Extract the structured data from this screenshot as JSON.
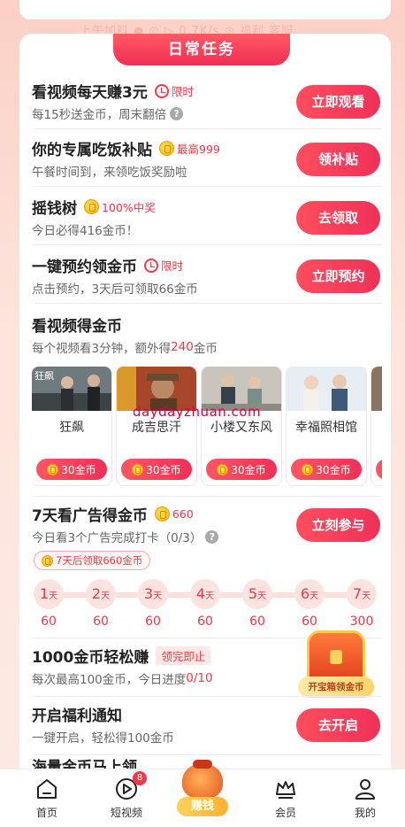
{
  "ghost_text": "上午加料 ● ◎ ▷ 0.7K/s ◎ 福利 客服",
  "section_title": "日常任务",
  "tasks": [
    {
      "name": "看视频每天赚3元",
      "badge": "限时",
      "desc": "每15秒送金币，周末翻倍",
      "button": "立即观看"
    },
    {
      "name": "你的专属吃饭补贴",
      "badge": "最高999",
      "desc": "午餐时间到，来领吃饭奖励啦",
      "button": "领补贴"
    },
    {
      "name": "摇钱树",
      "badge": "100%中奖",
      "desc": "今日必得416金币！",
      "button": "去领取"
    },
    {
      "name": "一键预约领金币",
      "badge": "限时",
      "desc": "点击预约，3天后可领取66金币",
      "button": "立即预约"
    }
  ],
  "video_section": {
    "title": "看视频得金币",
    "desc_prefix": "每个视频看3分钟，额外得",
    "desc_highlight": "240",
    "desc_suffix": "金币",
    "videos": [
      {
        "title": "狂飙",
        "reward": "30金币",
        "poster_text": "狂飙"
      },
      {
        "title": "成吉思汗",
        "reward": "30金币"
      },
      {
        "title": "小楼又东风",
        "reward": "30金币"
      },
      {
        "title": "幸福照相馆",
        "reward": "30金币"
      }
    ]
  },
  "watermark": "daydayzhuan.com",
  "ad_task": {
    "name": "7天看广告得金币",
    "badge": "660",
    "desc": "今日看3个广告完成打卡（0/3）",
    "button": "立刻参与",
    "chip": "7天后领取660金币",
    "day_unit": "天",
    "days": [
      {
        "day": "1",
        "reward": "60"
      },
      {
        "day": "2",
        "reward": "60"
      },
      {
        "day": "3",
        "reward": "60"
      },
      {
        "day": "4",
        "reward": "60"
      },
      {
        "day": "5",
        "reward": "60"
      },
      {
        "day": "6",
        "reward": "60"
      },
      {
        "day": "7",
        "reward": "300"
      }
    ]
  },
  "easy_task": {
    "name": "1000金币轻松赚",
    "tag": "领完即止",
    "desc_prefix": "每次最高100金币，今日进度",
    "desc_progress": "0/10"
  },
  "treasure_label": "开宝箱领金币",
  "notify_task": {
    "name": "开启福利通知",
    "desc": "一键开启，轻松得100金币",
    "button": "去开启"
  },
  "next_task_partial": "海量金币马上领",
  "nav": {
    "home": "首页",
    "shorts": "短视频",
    "shorts_badge": "8",
    "earn": "赚钱",
    "member": "会员",
    "mine": "我的"
  },
  "colors": {
    "accent": "#f0394b",
    "background": "#fde3da"
  }
}
